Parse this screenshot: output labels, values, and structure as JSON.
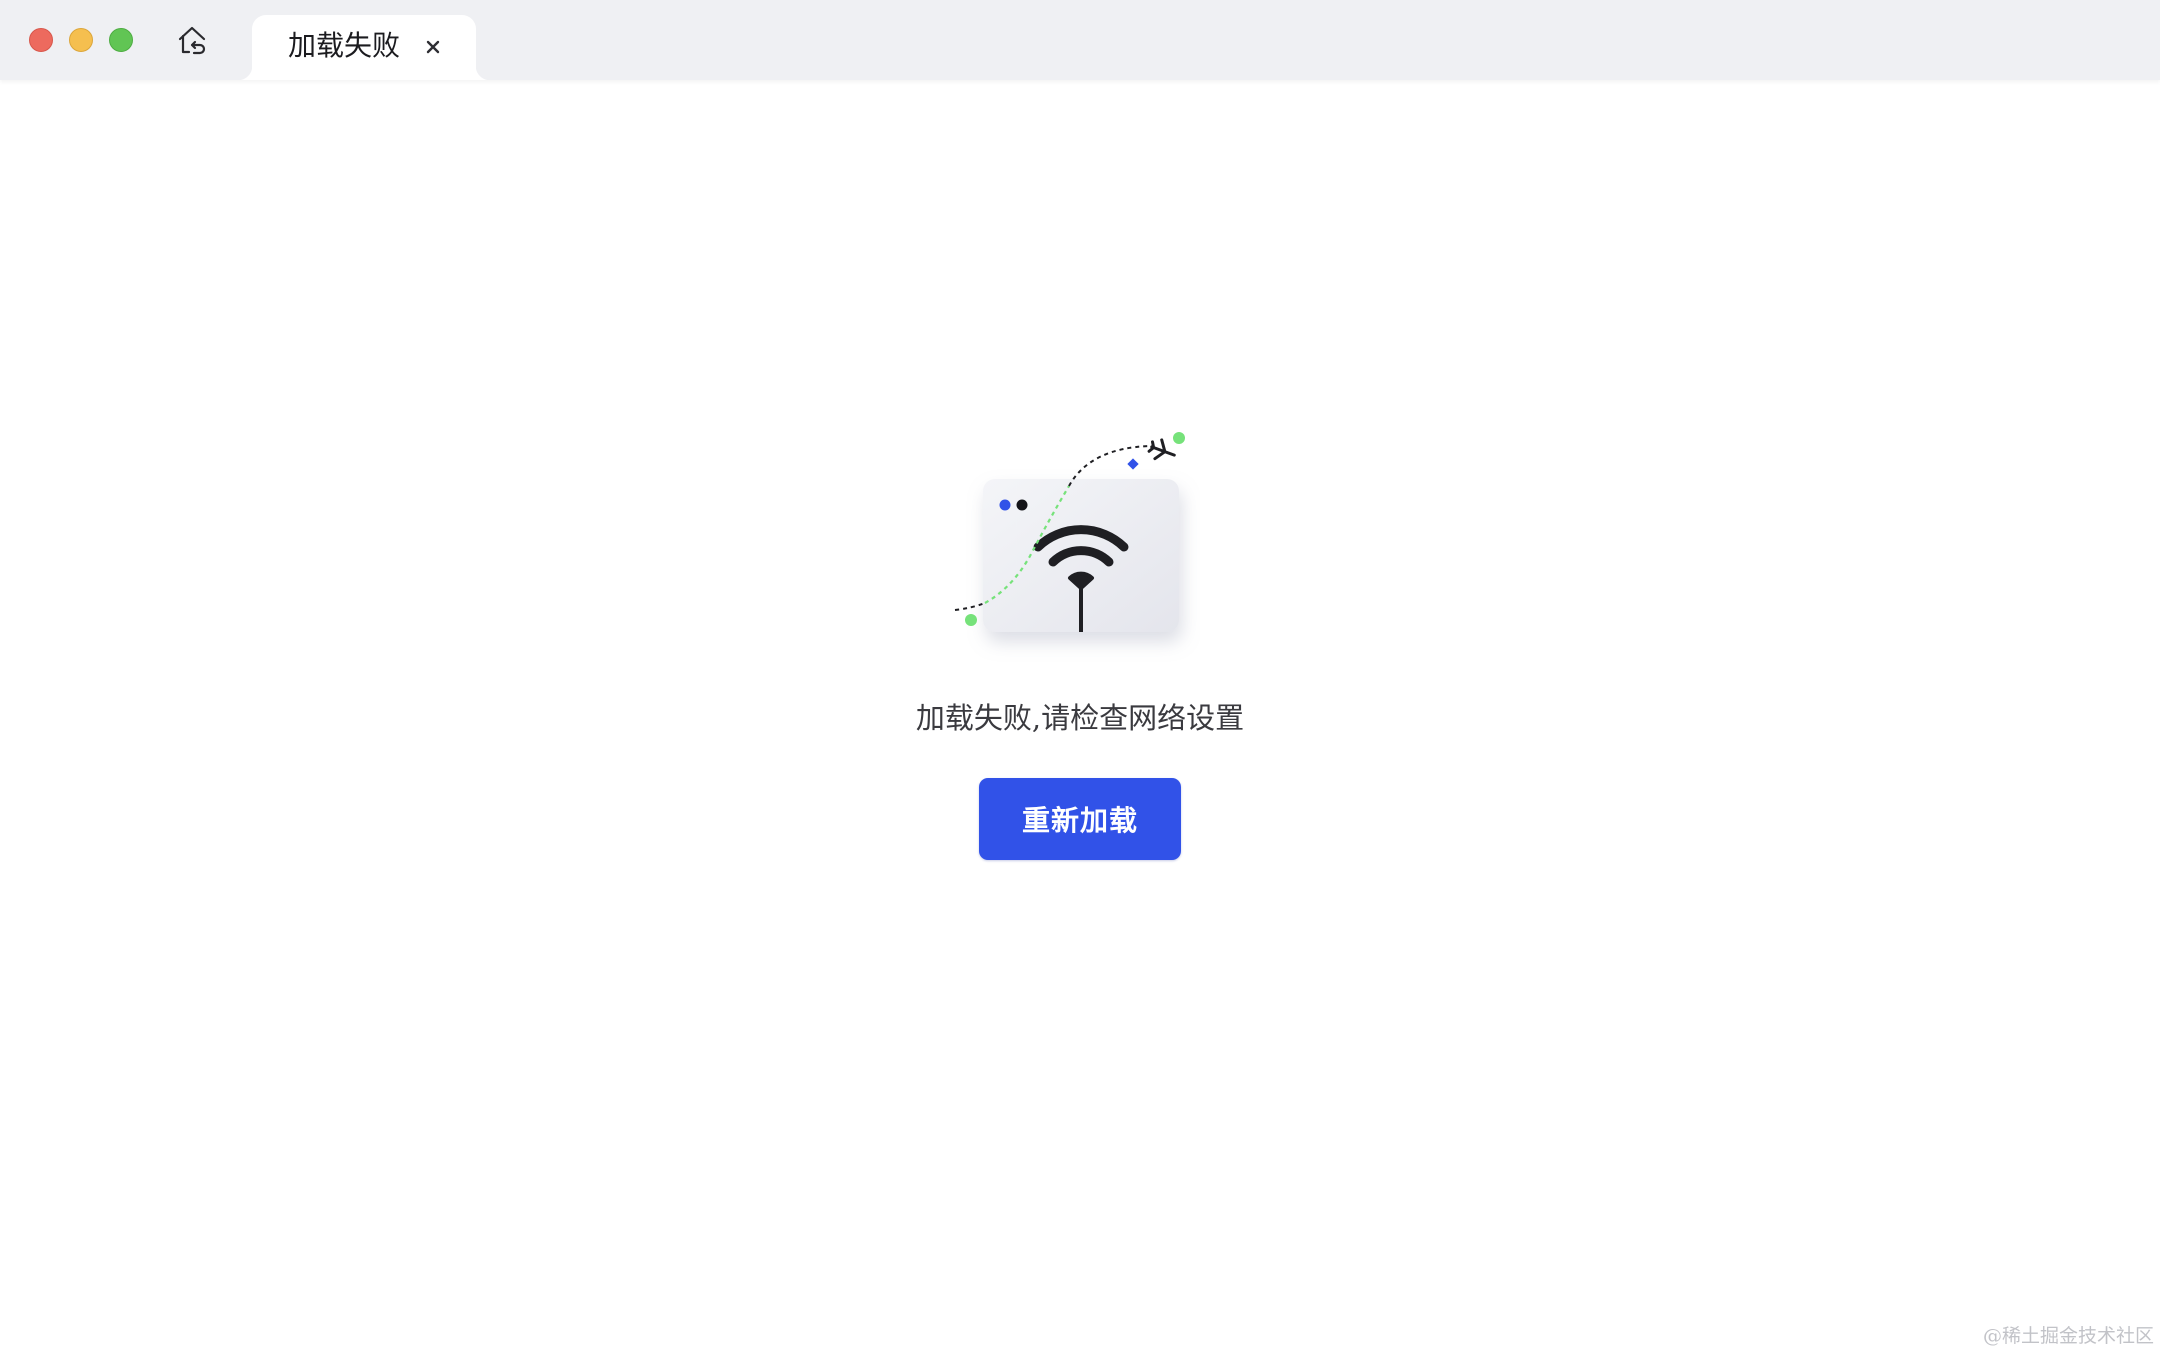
{
  "titlebar": {
    "tab": {
      "title": "加载失败",
      "close_icon": "close-icon"
    },
    "home_icon": "home-back-icon"
  },
  "error": {
    "illustration_icon": "wifi-error-illustration",
    "message": "加载失败,请检查网络设置",
    "reload_label": "重新加载"
  },
  "watermark": "@稀土掘金技术社区",
  "colors": {
    "accent": "#3152e8",
    "close": "#ed6a5e",
    "minimize": "#f5bf4f",
    "maximize": "#61c554",
    "path_green": "#6fe36a"
  }
}
